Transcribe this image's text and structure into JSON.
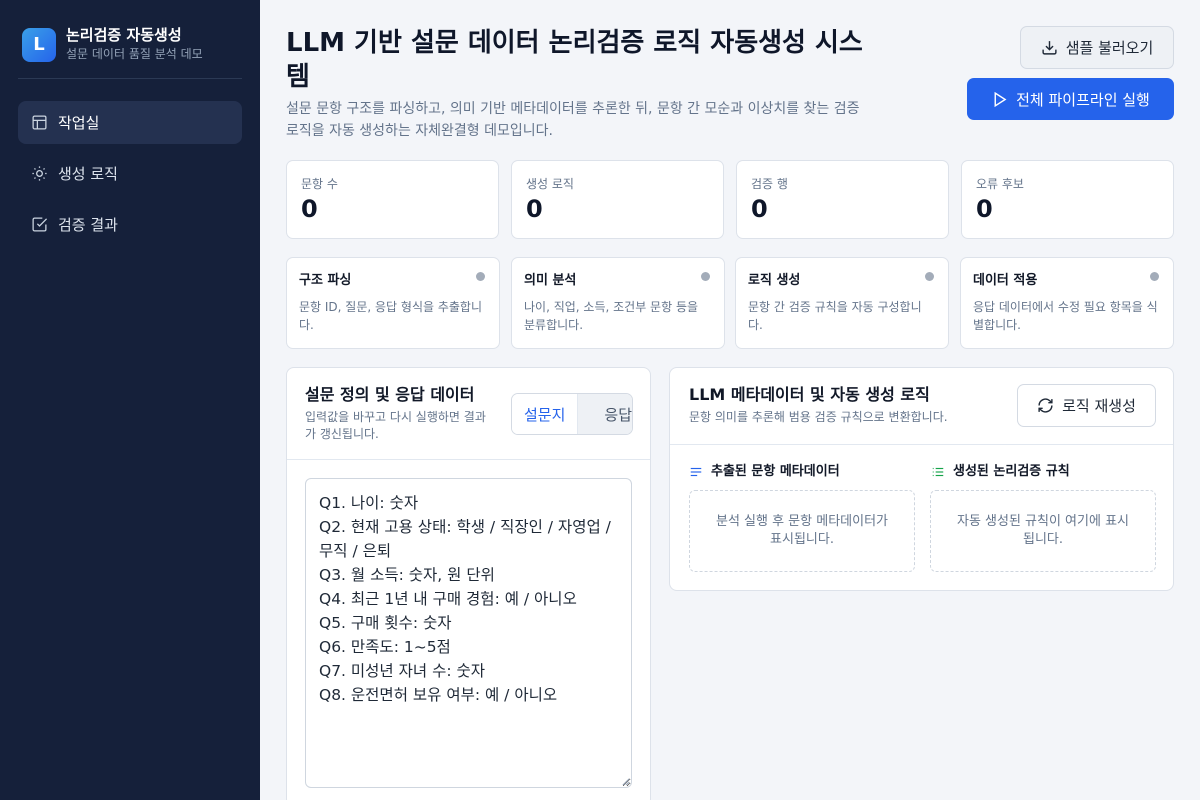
{
  "sidebar": {
    "logo_letter": "L",
    "title": "논리검증 자동생성",
    "subtitle": "설문 데이터 품질 분석 데모",
    "items": [
      {
        "label": "작업실",
        "icon": "layout-icon",
        "active": true
      },
      {
        "label": "생성 로직",
        "icon": "sun-icon",
        "active": false
      },
      {
        "label": "검증 결과",
        "icon": "check-square-icon",
        "active": false
      }
    ]
  },
  "header": {
    "title": "LLM 기반 설문 데이터 논리검증 로직 자동생성 시스템",
    "description": "설문 문항 구조를 파싱하고, 의미 기반 메타데이터를 추론한 뒤, 문항 간 모순과 이상치를 찾는 검증 로직을 자동 생성하는 자체완결형 데모입니다.",
    "load_button": "샘플 불러오기",
    "run_button": "전체 파이프라인 실행"
  },
  "stats": [
    {
      "label": "문항 수",
      "value": "0"
    },
    {
      "label": "생성 로직",
      "value": "0"
    },
    {
      "label": "검증 행",
      "value": "0"
    },
    {
      "label": "오류 후보",
      "value": "0"
    }
  ],
  "stages": [
    {
      "title": "구조 파싱",
      "desc": "문항 ID, 질문, 응답 형식을 추출합니다."
    },
    {
      "title": "의미 분석",
      "desc": "나이, 직업, 소득, 조건부 문항 등을 분류합니다."
    },
    {
      "title": "로직 생성",
      "desc": "문항 간 검증 규칙을 자동 구성합니다."
    },
    {
      "title": "데이터 적용",
      "desc": "응답 데이터에서 수정 필요 항목을 식별합니다."
    }
  ],
  "input_panel": {
    "title": "설문 정의 및 응답 데이터",
    "subtitle": "입력값을 바꾸고 다시 실행하면 결과가 갱신됩니다.",
    "tab_survey": "설문지",
    "tab_response": "응답",
    "survey_text": "Q1. 나이: 숫자\nQ2. 현재 고용 상태: 학생 / 직장인 / 자영업 / 무직 / 은퇴\nQ3. 월 소득: 숫자, 원 단위\nQ4. 최근 1년 내 구매 경험: 예 / 아니오\nQ5. 구매 횟수: 숫자\nQ6. 만족도: 1~5점\nQ7. 미성년 자녀 수: 숫자\nQ8. 운전면허 보유 여부: 예 / 아니오"
  },
  "output_panel": {
    "title": "LLM 메타데이터 및 자동 생성 로직",
    "subtitle": "문항 의미를 추론해 범용 검증 규칙으로 변환합니다.",
    "regen_button": "로직 재생성",
    "metadata_heading": "추출된 문항 메타데이터",
    "metadata_empty": "분석 실행 후 문항 메타데이터가 표시됩니다.",
    "rules_heading": "생성된 논리검증 규칙",
    "rules_empty": "자동 생성된 규칙이 여기에 표시됩니다.",
    "colors": {
      "metadata_icon": "#2563eb",
      "rules_icon": "#16a34a"
    }
  },
  "colors": {
    "primary": "#2563eb",
    "sidebar_bg": "#15203a"
  }
}
